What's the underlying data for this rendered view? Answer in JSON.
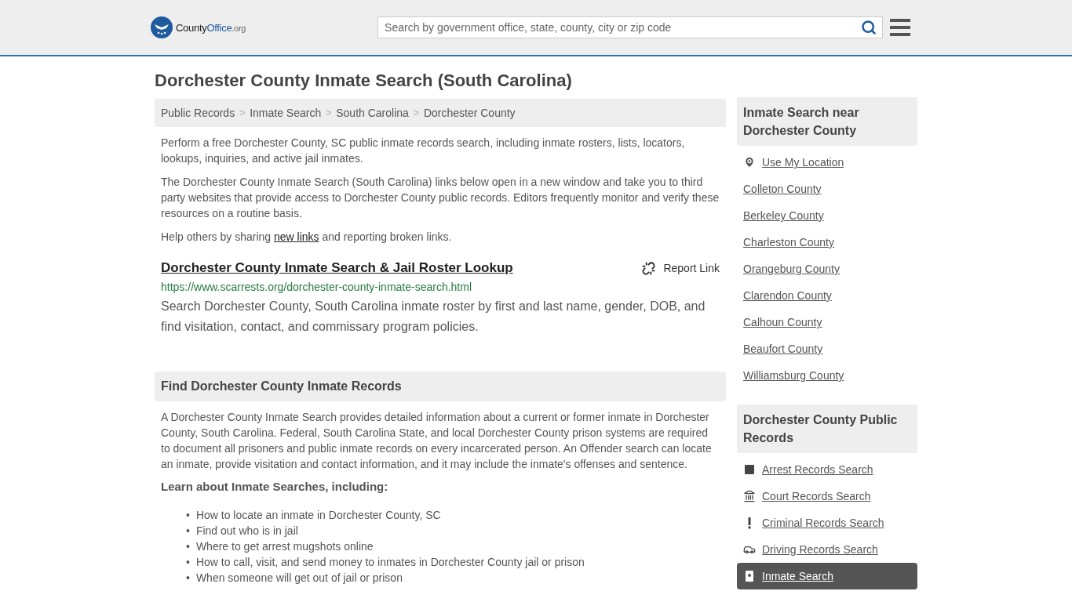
{
  "header": {
    "logo": {
      "part_1": "County",
      "part_2": "Office",
      "part_3": ".org"
    },
    "search": {
      "placeholder": "Search by government office, state, county, city or zip code"
    }
  },
  "title": "Dorchester County Inmate Search (South Carolina)",
  "breadcrumbs": [
    {
      "label": "Public Records"
    },
    {
      "separator": ">",
      "label": "Inmate Search"
    },
    {
      "separator": ">",
      "label": "South Carolina"
    },
    {
      "separator": ">",
      "label": "Dorchester County"
    }
  ],
  "intro": [
    "Perform a free Dorchester County, SC public inmate records search, including inmate rosters, lists, locators, lookups, inquiries, and active jail inmates.",
    "The Dorchester County Inmate Search (South Carolina) links below open in a new window and take you to third party websites that provide access to Dorchester County public records. Editors frequently monitor and verify these resources on a routine basis."
  ],
  "share": {
    "before": "Help others by sharing",
    "link": "new links",
    "after": "and reporting broken links."
  },
  "results": [
    {
      "title": "Dorchester County Inmate Search & Jail Roster Lookup",
      "report": "Report Link",
      "url": "https://www.scarrests.org/dorchester-county-inmate-search.html",
      "description": "Search Dorchester County, South Carolina inmate roster by first and last name, gender, DOB, and find visitation, contact, and commissary program policies."
    }
  ],
  "section": {
    "heading": "Find Dorchester County Inmate Records",
    "paragraph": "A Dorchester County Inmate Search provides detailed information about a current or former inmate in Dorchester County, South Carolina. Federal, South Carolina State, and local Dorchester County prison systems are required to document all prisoners and public inmate records on every incarcerated person. An Offender search can locate an inmate, provide visitation and contact information, and it may include the inmate's offenses and sentence.",
    "subheading": "Learn about Inmate Searches, including:",
    "bullets": [
      {
        "marker": "•",
        "text": "How to locate an inmate in Dorchester County, SC"
      },
      {
        "marker": "•",
        "text": "Find out who is in jail"
      },
      {
        "marker": "•",
        "text": "Where to get arrest mugshots online"
      },
      {
        "marker": "•",
        "text": "How to call, visit, and send money to inmates in Dorchester County jail or prison"
      },
      {
        "marker": "•",
        "text": "When someone will get out of jail or prison"
      }
    ]
  },
  "sidebar": [
    {
      "heading": "Inmate Search near Dorchester County",
      "items": [
        {
          "label": "Use My Location",
          "kind": "location",
          "selected": false
        },
        {
          "label": "Colleton County",
          "kind": "plain",
          "selected": false
        },
        {
          "label": "Berkeley County",
          "kind": "plain",
          "selected": false
        },
        {
          "label": "Charleston County",
          "kind": "plain",
          "selected": false
        },
        {
          "label": "Orangeburg County",
          "kind": "plain",
          "selected": false
        },
        {
          "label": "Clarendon County",
          "kind": "plain",
          "selected": false
        },
        {
          "label": "Calhoun County",
          "kind": "plain",
          "selected": false
        },
        {
          "label": "Beaufort County",
          "kind": "plain",
          "selected": false
        },
        {
          "label": "Williamsburg County",
          "kind": "plain",
          "selected": false
        }
      ]
    },
    {
      "heading": "Dorchester County Public Records",
      "items": [
        {
          "label": "Arrest Records Search",
          "kind": "square",
          "selected": false
        },
        {
          "label": "Court Records Search",
          "kind": "court",
          "selected": false
        },
        {
          "label": "Criminal Records Search",
          "kind": "exclamation",
          "selected": false
        },
        {
          "label": "Driving Records Search",
          "kind": "car",
          "selected": false
        },
        {
          "label": "Inmate Search",
          "kind": "badge",
          "selected": true
        }
      ]
    }
  ]
}
